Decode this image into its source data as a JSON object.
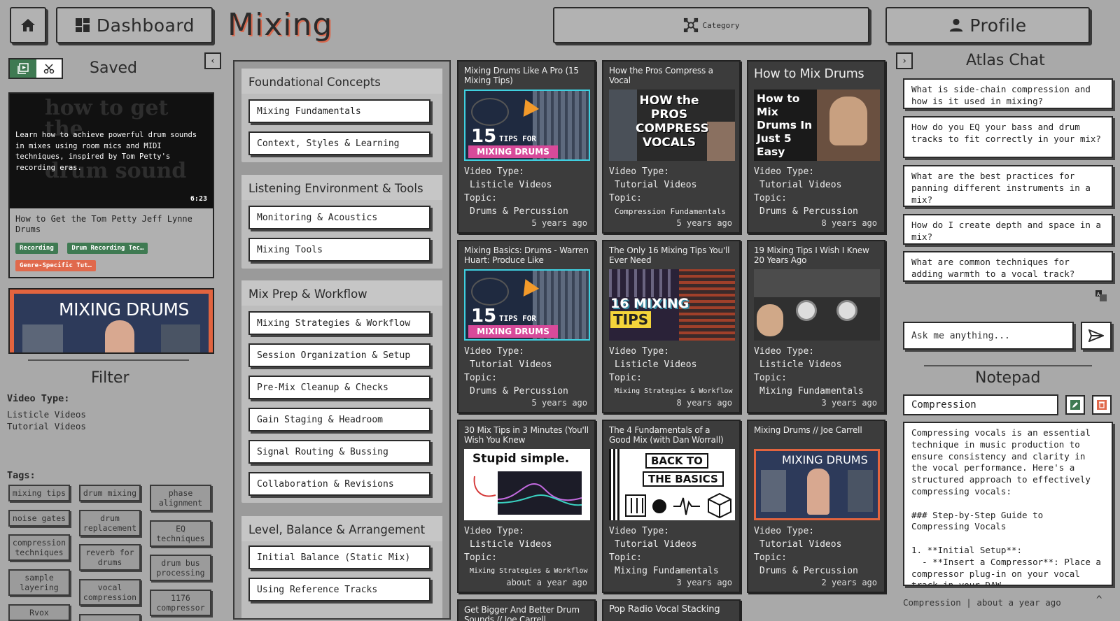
{
  "header": {
    "home_icon": "home-icon",
    "dashboard_label": "Dashboard",
    "page_title": "Mixing",
    "category_label": "Category",
    "profile_label": "Profile"
  },
  "saved": {
    "title": "Saved",
    "video1": {
      "description": "Learn how to achieve powerful drum sounds in mixes using room mics and MIDI techniques, inspired by Tom Petty's recording eras.",
      "duration": "6:23",
      "title": "How to Get the Tom Petty Jeff Lynne Drums",
      "chips": [
        "Recording",
        "Drum Recording Tec…",
        "Genre-Specific Tut…"
      ]
    },
    "video2": {
      "thumb_text": "MIXING DRUMS"
    }
  },
  "filter": {
    "title": "Filter",
    "video_type_label": "Video Type:",
    "video_types": [
      "Listicle Videos",
      "Tutorial Videos"
    ],
    "tags_label": "Tags:",
    "tags": [
      "mixing tips",
      "drum mixing",
      "phase alignment",
      "noise gates",
      "drum replacement",
      "compression techniques",
      "EQ techniques",
      "reverb for drums",
      "sample layering",
      "drum bus processing",
      "vocal compression",
      "1176 compressor",
      "Rvox"
    ]
  },
  "categories": [
    {
      "title": "Foundational Concepts",
      "topics": [
        "Mixing Fundamentals",
        "Context, Styles & Learning"
      ]
    },
    {
      "title": "Listening Environment & Tools",
      "topics": [
        "Monitoring & Acoustics",
        "Mixing Tools"
      ]
    },
    {
      "title": "Mix Prep & Workflow",
      "topics": [
        "Mixing Strategies & Workflow",
        "Session Organization & Setup",
        "Pre-Mix Cleanup & Checks",
        "Gain Staging & Headroom",
        "Signal Routing & Bussing",
        "Collaboration & Revisions"
      ]
    },
    {
      "title": "Level, Balance & Arrangement",
      "topics": [
        "Initial Balance (Static Mix)",
        "Using Reference Tracks"
      ]
    }
  ],
  "videos": {
    "labels": {
      "type": "Video Type:",
      "topic": "Topic:"
    },
    "items": [
      {
        "title": "Mixing Drums Like A Pro (15 Mixing Tips)",
        "type": "Listicle Videos",
        "topic": "Drums & Percussion",
        "age": "5 years ago",
        "thumb_big": "15",
        "thumb_small": "TIPS FOR",
        "thumb_band": "MIXING DRUMS"
      },
      {
        "title": "How the Pros Compress a Vocal",
        "type": "Tutorial Videos",
        "topic": "Compression Fundamentals",
        "age": "5 years ago",
        "thumb_text": "HOW the PROS COMPRESS VOCALS"
      },
      {
        "title": "How to Mix Drums",
        "type": "Tutorial Videos",
        "topic": "Drums & Percussion",
        "age": "8 years ago",
        "thumb_text": "How to Mix Drums In Just 5 Easy Steps"
      },
      {
        "title": "Mixing Basics: Drums - Warren Huart: Produce Like",
        "type": "Tutorial Videos",
        "topic": "Drums & Percussion",
        "age": "5 years ago",
        "thumb_big": "15",
        "thumb_small": "TIPS FOR",
        "thumb_band": "MIXING DRUMS"
      },
      {
        "title": "The Only 16 Mixing Tips You'll Ever Need",
        "type": "Listicle Videos",
        "topic": "Mixing Strategies & Workflow",
        "age": "8 years ago",
        "thumb_line1": "16 MIXING",
        "thumb_line2": "TIPS"
      },
      {
        "title": "19 Mixing Tips I Wish I Knew 20 Years Ago",
        "type": "Listicle Videos",
        "topic": "Mixing Fundamentals",
        "age": "3 years ago"
      },
      {
        "title": "30 Mix Tips in 3 Minutes (You'll Wish You Knew",
        "type": "Listicle Videos",
        "topic": "Mixing Strategies & Workflow",
        "age": "about a year ago",
        "thumb_text": "Stupid simple."
      },
      {
        "title": "The 4 Fundamentals of a Good Mix (with Dan Worrall)",
        "type": "Tutorial Videos",
        "topic": "Mixing Fundamentals",
        "age": "3 years ago",
        "thumb_line1": "BACK TO",
        "thumb_line2": "THE BASICS"
      },
      {
        "title": "Mixing Drums // Joe Carrell",
        "type": "Tutorial Videos",
        "topic": "Drums & Percussion",
        "age": "2 years ago",
        "thumb_text": "MIXING DRUMS"
      },
      {
        "title": "Get Bigger And Better Drum Sounds // Joe Carrell"
      },
      {
        "title": "Pop Radio Vocal Stacking"
      }
    ]
  },
  "chat": {
    "title": "Atlas Chat",
    "questions": [
      "What is side-chain compression and how is it used in mixing?",
      "How do you EQ your bass and drum tracks to fit correctly in your mix?",
      "What are the best practices for panning different instruments in a mix?",
      "How do I create depth and space in a mix?",
      "What are common techniques for adding warmth to a vocal track?"
    ],
    "input_placeholder": "Ask me anything..."
  },
  "notepad": {
    "title": "Notepad",
    "note_title": "Compression",
    "body": "Compressing vocals is an essential technique in music production to ensure consistency and clarity in the vocal performance. Here's a structured approach to effectively compressing vocals:\n\n### Step-by-Step Guide to Compressing Vocals\n\n1. **Initial Setup**:\n  - **Insert a Compressor**: Place a compressor plug-in on your vocal track in your DAW",
    "footer": "Compression | about a year ago"
  },
  "colors": {
    "accent_orange": "#e0694c",
    "accent_green": "#3f7a52",
    "card_dark": "#3c3c3c",
    "bg": "#a9a9a9"
  }
}
